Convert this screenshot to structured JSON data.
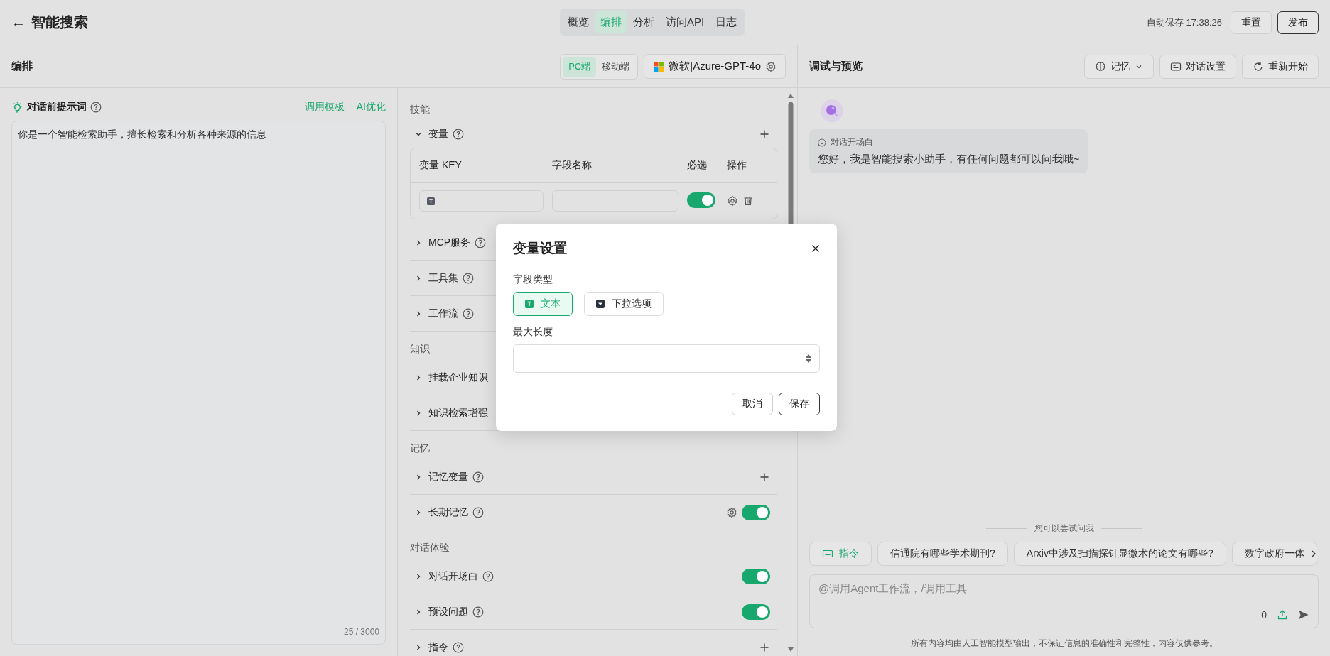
{
  "top_bar": {
    "back": "←",
    "title": "智能搜索",
    "tabs": [
      {
        "label": "概览",
        "selected": false
      },
      {
        "label": "编排",
        "selected": true
      },
      {
        "label": "分析",
        "selected": false
      },
      {
        "label": "访问API",
        "selected": false
      },
      {
        "label": "日志",
        "selected": false
      }
    ],
    "autosave": "自动保存 17:38:26",
    "buttons": [
      {
        "label": "重置",
        "kind": "plain"
      },
      {
        "label": "发布",
        "kind": "outline"
      }
    ]
  },
  "editor": {
    "title": "编排",
    "platforms": [
      {
        "label": "PC端",
        "selected": true
      },
      {
        "label": "移动端",
        "selected": false
      }
    ],
    "model": "微软|Azure-GPT-4o",
    "prompt": {
      "title": "对话前提示词",
      "links": [
        "调用模板",
        "AI优化"
      ],
      "value": "你是一个智能检索助手，擅长检索和分析各种来源的信息",
      "counter": "25 / 3000"
    },
    "skills_title": "技能",
    "variables": {
      "label": "变量",
      "expanded": true,
      "columns": [
        "变量 KEY",
        "字段名称",
        "必选",
        "操作"
      ],
      "rows": [
        {
          "required": true
        }
      ]
    },
    "groups": [
      {
        "items": [
          {
            "label": "MCP服务",
            "kind": "none"
          },
          {
            "label": "工具集",
            "kind": "none"
          },
          {
            "label": "工作流",
            "kind": "none"
          }
        ]
      },
      {
        "title": "知识",
        "items": [
          {
            "label": "挂载企业知识",
            "kind": "plain"
          },
          {
            "label": "知识检索增强",
            "kind": "plain"
          }
        ]
      },
      {
        "title": "记忆",
        "items": [
          {
            "label": "记忆变量",
            "kind": "add"
          },
          {
            "label": "长期记忆",
            "kind": "settings_toggle",
            "on": true
          }
        ]
      },
      {
        "title": "对话体验",
        "items": [
          {
            "label": "对话开场白",
            "kind": "toggle",
            "on": true
          },
          {
            "label": "预设问题",
            "kind": "toggle",
            "on": true
          },
          {
            "label": "指令",
            "kind": "add"
          }
        ]
      }
    ]
  },
  "preview": {
    "title": "调试与预览",
    "buttons": [
      {
        "label": "记忆",
        "kind": "memory"
      },
      {
        "label": "对话设置",
        "kind": "settings"
      },
      {
        "label": "重新开始",
        "kind": "restart"
      }
    ],
    "greeting": {
      "label": "对话开场白",
      "text": "您好，我是智能搜索小助手，有任何问题都可以问我哦~"
    },
    "suggest_title": "您可以尝试问我",
    "command": "指令",
    "suggestions": [
      "信通院有哪些学术期刊?",
      "Arxiv中涉及扫描探针显微术的论文有哪些?",
      "数字政府一体"
    ],
    "input": {
      "placeholder": "@调用Agent工作流，/调用工具",
      "count": "0"
    },
    "disclaimer": "所有内容均由人工智能模型输出，不保证信息的准确性和完整性，内容仅供参考。"
  },
  "dialog": {
    "title": "变量设置",
    "type_label": "字段类型",
    "types": [
      {
        "label": "文本",
        "kind": "text",
        "selected": true
      },
      {
        "label": "下拉选项",
        "kind": "select",
        "selected": false
      }
    ],
    "length_label": "最大长度",
    "buttons": [
      {
        "label": "取消",
        "kind": "plain"
      },
      {
        "label": "保存",
        "kind": "outline"
      }
    ]
  }
}
